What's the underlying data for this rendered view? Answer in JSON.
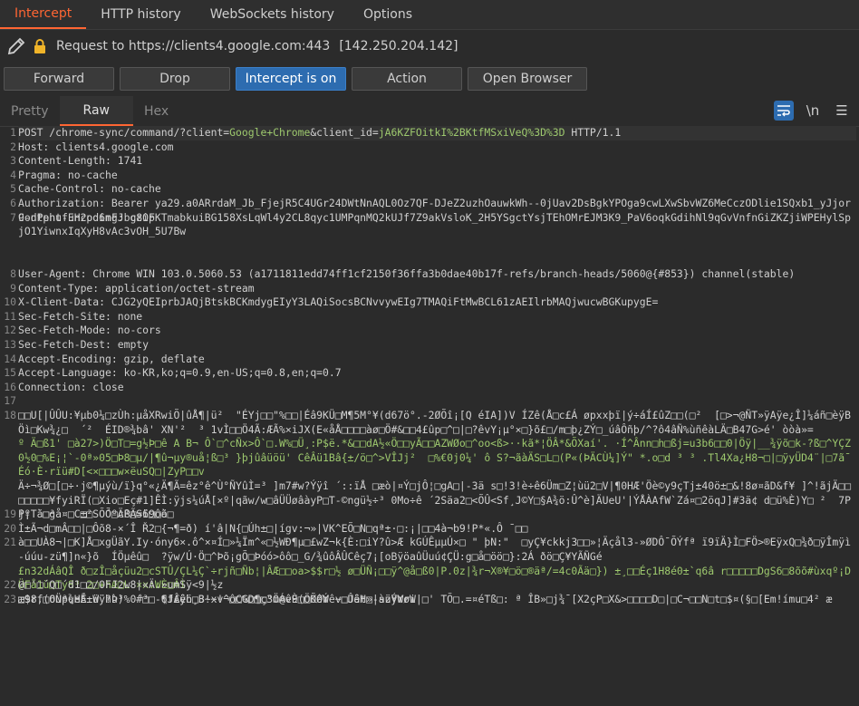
{
  "tabs": [
    "Intercept",
    "HTTP history",
    "WebSockets history",
    "Options"
  ],
  "request_label": "Request to https://clients4.google.com:443",
  "request_ip": "[142.250.204.142]",
  "buttons": {
    "forward": "Forward",
    "drop": "Drop",
    "intercept": "Intercept is on",
    "action": "Action",
    "open_browser": "Open Browser"
  },
  "view_tabs": [
    "Pretty",
    "Raw",
    "Hex"
  ],
  "view_tools": {
    "newline": "\\n"
  },
  "lines": [
    {
      "n": "1",
      "parts": [
        [
          "POST /chrome-sync/command/?client=",
          "a"
        ],
        [
          "Google+Chrome",
          "g"
        ],
        [
          "&client_id=",
          "a"
        ],
        [
          "jA6KZFOitkI%2BKtfMSxiVeQ%3D%3D",
          "g"
        ],
        [
          " HTTP/1.1",
          "a"
        ]
      ]
    },
    {
      "n": "2",
      "text": "Host: clients4.google.com"
    },
    {
      "n": "3",
      "text": "Content-Length: 1741"
    },
    {
      "n": "4",
      "text": "Pragma: no-cache"
    },
    {
      "n": "5",
      "text": "Cache-Control: no-cache"
    },
    {
      "n": "6",
      "text": "Authorization: Bearer ya29.a0ARrdaM_Jb_FjejR5C4UGr24DWtNnAQL0Oz7QF-DJeZ2uzhOauwkWh--0jUav2DsBgkYPOga9cwLXwSbvWZ6MeCczODlie1SQxb1_yJjor9-dPphufuH2pd6mFJbc8OFKTmabkuiBG158XsLqWl4y2CL8qyc1UMPqnMQ2kUJf7Z9akVsloK_2H5YSgctYsjTEhOMrEJM3K9_PaV6oqkGdihNl9qGvVnfnGiZKZjiWPEHylSpjO1YiwnxIqXyH8vAc3vOH_5U7Bw"
    },
    {
      "n": "7",
      "text": "Content-Encoding: gzip"
    },
    {
      "n": "8",
      "text": "User-Agent: Chrome WIN 103.0.5060.53 (a1711811edd74ff1cf2150f36ffa3b0dae40b17f-refs/branch-heads/5060@{#853}) channel(stable)"
    },
    {
      "n": "9",
      "text": "Content-Type: application/octet-stream"
    },
    {
      "n": "10",
      "text": "X-Client-Data: CJG2yQEIprbJAQjBtskBCKmdygEIyY3LAQiSocsBCNvvywEIg7TMAQiFtMwBCL61zAEIlrbMAQjwucwBGKupygE="
    },
    {
      "n": "11",
      "text": "Sec-Fetch-Site: none"
    },
    {
      "n": "12",
      "text": "Sec-Fetch-Mode: no-cors"
    },
    {
      "n": "13",
      "text": "Sec-Fetch-Dest: empty"
    },
    {
      "n": "14",
      "text": "Accept-Encoding: gzip, deflate"
    },
    {
      "n": "15",
      "text": "Accept-Language: ko-KR,ko;q=0.9,en-US;q=0.8,en;q=0.7"
    },
    {
      "n": "16",
      "text": "Connection: close"
    },
    {
      "n": "17",
      "text": ""
    },
    {
      "n": "18",
      "parts": [
        [
          "□□U[|ÛÛU:¥µb0¼□zÙh:µåXRwiÕ|ûÅ¶|ü²  \"ÉYj□□\"%□□|Éâ9KÜ□M¶5M°¥(d67ö°.-2ØÕî¡[Q éIA])V ÍZê(Å□c£Á øpxxþï|ý÷áÍ£ûZ□□(□²  [□>¬@ÑT»ÿAÿe¿Î]¼áñ□èÿBÖì□Kw¾¿□  ´²  ÉID®¾bâ' XN'²  ³ 1vÌ□□Ö4Ã:ÆÃ%×iJX(E«åÅ□□□□àø□Ö#&□□4£ûp□^□|□?êvY¡µ°×□}õ£□/m□þ¿ZÝ□_úâÔñþ/^?ô4âÑ%ùñêàLÄ□B47G>é' òòà»=\n",
          "a"
        ],
        [
          "º Ä□ß1' □à27>)Ö□T□=g½Þ□ê A B¬ Ô`□^cÑx>Ô`□.W%□Ü¸:P$ë.*&□□dA½«Ö□□yÃ□□AZWØo□^oo<ß>··kã*¦ÖÂ*&ÕXaí'. ·Í^Ânn□h□ßj=u3b6□□0|Öÿ|__¾ÿõ□k-?ß□^YÇZ0½0□%E¡¦`-0ª»05□Þ8□µ/|¶û¬µy®uå¦ß□³ }þjûâüöü' CêÂü1Bâ{±/ö□^>VÎJj²  □%€0j0¼' ô S?¬ãàÄS□L□(P«(ÞÄCÙ¼]Ý\" *.o□d ³ ³ .Tl4Xa¿H8¬□|□ÿyÜD4¨|□7ã¯Éó·È·rïü#D[<×□□□w×ëuSQ□|ZyP□□v",
          "g"
        ],
        [
          "\nÄ÷¬¾Ø□[□÷·j©¶µýù/ï}q°«¿Ä¶Ã=êz°ê^Ù°ÑYûÌ=³ ]m7#w?Ýÿî ´::ïÅ □æò|¤Ý□jÔ¦□gA□|-3ä s□!3!è÷ê6Üm□Z¦ùü2□V|¶0HÆ'Öè©y9çTj±40ö±□&!8ø¤ãD&f¥ ]^!ãjÄ□□□□□□□¥fyiRÏ(□Xio□Eç#1]ÊÌ:ÿjs¼úÅ[×º|qãw/w□âÜÜøâàyP□T-©ngü½÷³ 0Mo÷ê ´2Säa2□<ÕÛ<Sf¸J©Y□§A¾ö:Û^è]ÄUeU'|ÝÅÀAfW`Zá¤□2öqJ]#3ä¢ d□ü%È)Y□ ²  7PP¡T`□gå¤  ±²  ´ºÄßÃ=6□ôà\n",
          "a"
        ],
        [
          "Ì±Ã¬d□mÂ□□|□Ôõ8-×´Î Ř2□{¬¶=ð) í'â|N{□Úh±□|ígv:¬»|VK^EÕ□N□qª±·□:¡|□□4à¬b9!P*«.Ô ¯□□",
          "a"
        ]
      ]
    },
    {
      "n": "19",
      "parts": [
        [
          "jº ä□²  □C□□SÕÕ□cP□Sï9□õ□",
          "a"
        ]
      ]
    },
    {
      "n": "20",
      "parts": [
        [
          "",
          "a"
        ]
      ]
    },
    {
      "n": "21",
      "parts": [
        [
          "à□□UÀ8¬|□K]Å□xgÜãY.Iy·óny6×.ô^×¤Í□»¼Ïm^«□½WÐ¶µ□£wZ¬k{È:□iY?û>Æ kGÚÊµµÚ×□ \" þN:\"  □yÇ¥ckkj3□□»¦Äçål3-»ØDÔ¯ÕÝfª ï9ïÄ}Ì□FÖ>®EÿxQ□¾ð□ÿÎmÿì-úúu-zü¶]n«}õ  ÍÖµêû□  ?ÿw/Ú·Ö□^Þõ¡gÕ□Þóó>ôô□_G/¾ûôÂÛCêç7¡[oBÿöaûÜuú¢ÇÜ:g□å□öö□}:2Á ðö□Ç¥YÃÑGé\n",
          "a"
        ],
        [
          "£n32dÁâQÎ ð□zÎ□åçüu2□cSTÛ/ÇL¼Ç`÷rjñ□Ñb¦|ÂÆ□□oa>$$r□½ ø□ÜÑ¡□□ÿ^@å□ß0|P.0z|¾r¬X®¥□ö□®äª/=4c0Ãä□}) ±¸□□Éç1H8é0±`q6â r□□□□□DgS6□8õõ#ùxqº¡DÜFå1ü□Ty8³ 2□+hÆ□L ×x:WÈ□ÂÌ",
          "g"
        ],
        [
          "\n□$r,□ONpueÉ.Wÿhù³  ´□□-6f£ÿö□B~xv¬ô□GD□ç\"mÁêÈ□□ÕØÝêv□Ûät»-szÝWri|□' TÕ□.=¤éTß□: ª ÎB»□j¾¯[X2çP□X&>□□□□D□|□C¬□□N□t□$¤(§□[Em!ímu□4² æ",
          "a"
        ]
      ]
    },
    {
      "n": "22",
      "parts": [
        [
          "@□'□´Q□´d1□□/OFJ2w8|«Ä.»umSÿ<9|½z",
          "a"
        ]
      ]
    },
    {
      "n": "23",
      "parts": [
        [
          "æ98f(6Üª¾HÃ±ü¨?Þ)%0#³  ¶JÂêh¸3!~!^□C%□¶□3Ö@v9(ÖKêW ~□JêH□|àüÿYøW",
          "a"
        ]
      ]
    }
  ]
}
